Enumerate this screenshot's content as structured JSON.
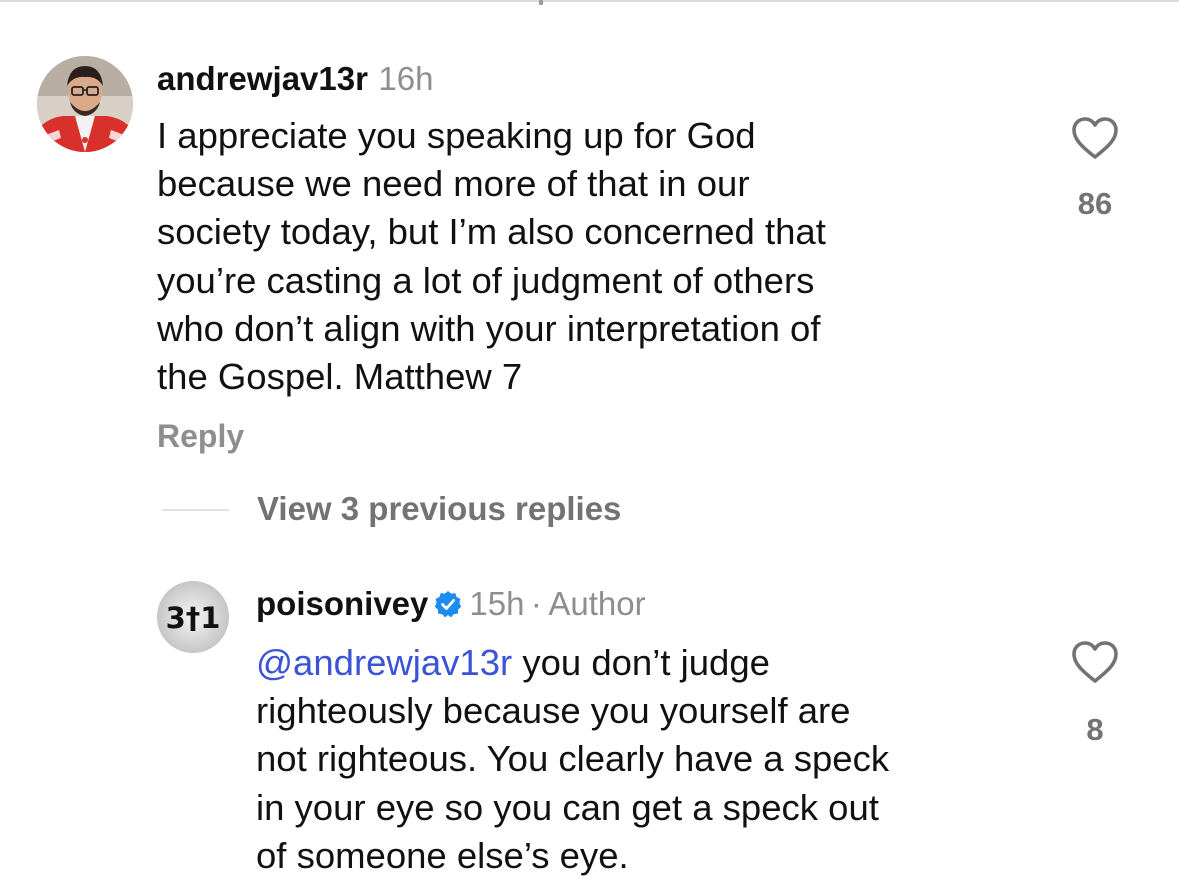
{
  "comments": [
    {
      "username": "andrewjav13r",
      "time": "16h",
      "text": [
        "I appreciate you speaking up for God",
        "because we need more of that in our",
        "society today, but I’m also concerned that",
        "you’re casting a lot of judgment of others",
        "who don’t align with your interpretation of",
        "the Gospel. Matthew 7"
      ],
      "likes": "86",
      "reply_label": "Reply",
      "avatar_icon": "user-photo-icon"
    },
    {
      "username": "poisonivey",
      "verified": true,
      "time": "15h",
      "separator": "·",
      "author_label": "Author",
      "mention": "@andrewjav13r",
      "text_first": " you don’t judge",
      "text": [
        "righteously because you yourself are",
        "not righteous. You clearly have a speck",
        "in your eye so you can get a speck out",
        "of someone else’s eye."
      ],
      "likes": "8",
      "avatar_text": "3†1"
    }
  ],
  "view_replies_label": "View 3 previous replies",
  "colors": {
    "mention": "#3b53d6",
    "verified": "#1d8cf0",
    "muted": "#8e8e8e"
  }
}
